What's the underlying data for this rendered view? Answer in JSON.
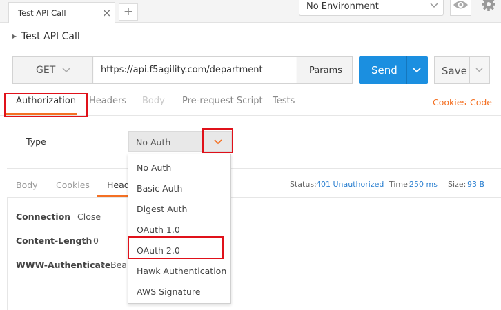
{
  "tabs": {
    "request_tab_title": "Test API Call",
    "close_glyph": "×",
    "new_tab_glyph": "+"
  },
  "environment": {
    "selected": "No Environment"
  },
  "request": {
    "title": "Test API Call",
    "method": "GET",
    "url": "https://api.f5agility.com/department",
    "params_label": "Params",
    "send_label": "Send",
    "save_label": "Save"
  },
  "request_tabs": {
    "items": [
      {
        "label": "Authorization",
        "state": "active"
      },
      {
        "label": "Headers",
        "state": "normal"
      },
      {
        "label": "Body",
        "state": "disabled"
      },
      {
        "label": "Pre-request Script",
        "state": "normal"
      },
      {
        "label": "Tests",
        "state": "normal"
      }
    ],
    "cookies_link": "Cookies",
    "code_link": "Code"
  },
  "auth": {
    "type_label": "Type",
    "selected_type": "No Auth",
    "options": [
      "No Auth",
      "Basic Auth",
      "Digest Auth",
      "OAuth 1.0",
      "OAuth 2.0",
      "Hawk Authentication",
      "AWS Signature"
    ],
    "highlighted_option": "OAuth 2.0"
  },
  "response": {
    "tabs": [
      {
        "label": "Body",
        "active": false
      },
      {
        "label": "Cookies",
        "active": false
      },
      {
        "label": "Headers",
        "active": true
      }
    ],
    "status_label": "Status:",
    "status_value": "401 Unauthorized",
    "time_label": "Time:",
    "time_value": "250 ms",
    "size_label": "Size:",
    "size_value": "93 B",
    "headers": [
      {
        "key": "Connection",
        "value": "Close"
      },
      {
        "key": "Content-Length",
        "value": "0"
      },
      {
        "key": "WWW-Authenticate",
        "value": "Bearer"
      }
    ],
    "separator_glyph": "›"
  },
  "colors": {
    "accent_orange": "#f47023",
    "send_blue": "#1b8fe0",
    "highlight_red": "#e0111a",
    "status_blue": "#2a7fd0"
  },
  "icons": [
    "close-icon",
    "plus-icon",
    "chevron-down-icon",
    "eye-icon",
    "gear-icon",
    "caret-right-icon"
  ]
}
